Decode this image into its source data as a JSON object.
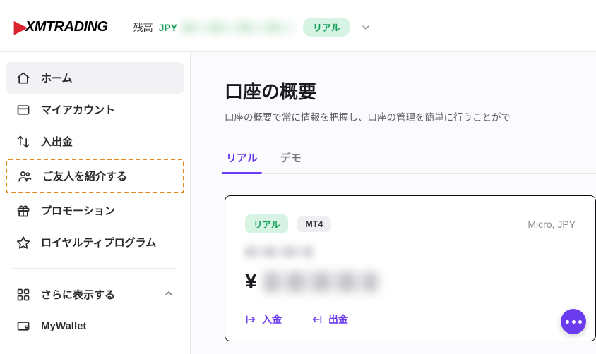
{
  "header": {
    "logo_text": "XMTRADING",
    "balance_label": "残高",
    "balance_currency": "JPY",
    "account_type_pill": "リアル"
  },
  "sidebar": {
    "items": [
      {
        "icon": "home",
        "label": "ホーム"
      },
      {
        "icon": "account",
        "label": "マイアカウント"
      },
      {
        "icon": "transfer",
        "label": "入出金"
      },
      {
        "icon": "refer",
        "label": "ご友人を紹介する"
      },
      {
        "icon": "gift",
        "label": "プロモーション"
      },
      {
        "icon": "star",
        "label": "ロイヤルティプログラム"
      }
    ],
    "more_label": "さらに表示する",
    "wallet_label": "MyWallet"
  },
  "main": {
    "title": "口座の概要",
    "subtitle": "口座の概要で常に情報を把握し、口座の管理を簡単に行うことがで",
    "tabs": [
      {
        "label": "リアル",
        "active": true
      },
      {
        "label": "デモ",
        "active": false
      }
    ],
    "card": {
      "pill_real": "リアル",
      "pill_platform": "MT4",
      "meta": "Micro, JPY",
      "currency_symbol": "¥",
      "action_deposit": "入金",
      "action_withdraw": "出金"
    }
  }
}
